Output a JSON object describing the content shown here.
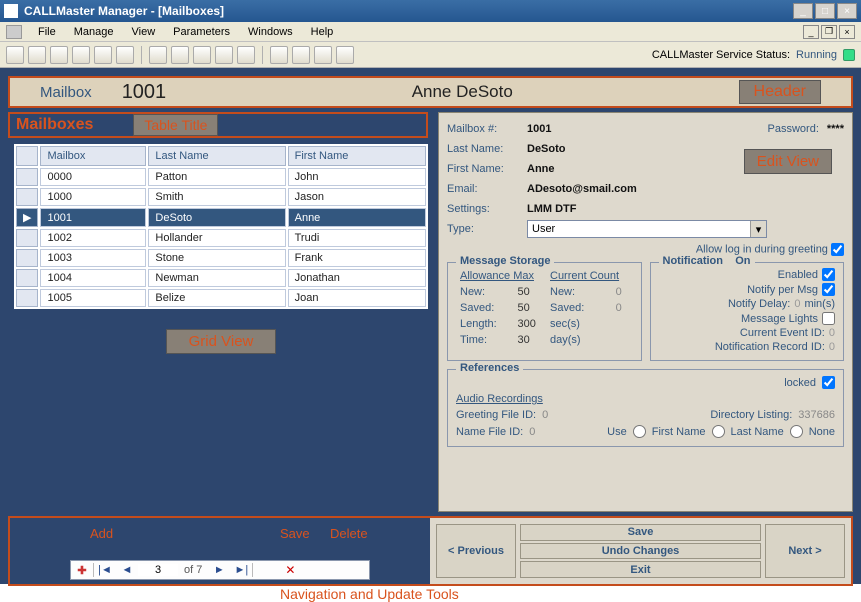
{
  "window": {
    "title": "CALLMaster Manager - [Mailboxes]",
    "min": "_",
    "max": "□",
    "close": "×"
  },
  "menu": {
    "file": "File",
    "manage": "Manage",
    "view": "View",
    "parameters": "Parameters",
    "windows": "Windows",
    "help": "Help"
  },
  "service": {
    "label": "CALLMaster Service Status:",
    "value": "Running"
  },
  "header": {
    "label": "Mailbox",
    "current_id": "1001",
    "current_name": "Anne DeSoto",
    "tag": "Header"
  },
  "tabletitle": {
    "label": "Mailboxes",
    "tag": "Table Title"
  },
  "gridview_tag": "Grid View",
  "grid": {
    "cols": {
      "mailbox": "Mailbox",
      "last": "Last Name",
      "first": "First Name"
    },
    "rows": [
      {
        "mailbox": "0000",
        "last": "Patton",
        "first": "John",
        "sel": false
      },
      {
        "mailbox": "1000",
        "last": "Smith",
        "first": "Jason",
        "sel": false
      },
      {
        "mailbox": "1001",
        "last": "DeSoto",
        "first": "Anne",
        "sel": true
      },
      {
        "mailbox": "1002",
        "last": "Hollander",
        "first": "Trudi",
        "sel": false
      },
      {
        "mailbox": "1003",
        "last": "Stone",
        "first": "Frank",
        "sel": false
      },
      {
        "mailbox": "1004",
        "last": "Newman",
        "first": "Jonathan",
        "sel": false
      },
      {
        "mailbox": "1005",
        "last": "Belize",
        "first": "Joan",
        "sel": false
      }
    ]
  },
  "edit": {
    "tag": "Edit View",
    "mailbox_label": "Mailbox #:",
    "mailbox": "1001",
    "pw_label": "Password:",
    "pw": "****",
    "last_label": "Last Name:",
    "last": "DeSoto",
    "first_label": "First Name:",
    "first": "Anne",
    "email_label": "Email:",
    "email": "ADesoto@smail.com",
    "settings_label": "Settings:",
    "settings": "LMM DTF",
    "type_label": "Type:",
    "type": "User",
    "allow_label": "Allow log in during greeting"
  },
  "msgstore": {
    "legend": "Message Storage",
    "allow_hdr": "Allowance Max",
    "count_hdr": "Current Count",
    "new_label": "New:",
    "new_max": "50",
    "new_cur": "0",
    "saved_label": "Saved:",
    "saved_max": "50",
    "saved_cur": "0",
    "len_label": "Length:",
    "len": "300",
    "len_unit": "sec(s)",
    "time_label": "Time:",
    "time": "30",
    "time_unit": "day(s)"
  },
  "notif": {
    "legend": "Notification",
    "state": "On",
    "enabled": "Enabled",
    "permsg": "Notify per Msg",
    "delay": "Notify Delay:",
    "delay_val": "0",
    "delay_unit": "min(s)",
    "lights": "Message Lights",
    "evt": "Current Event ID:",
    "evt_val": "0",
    "rec": "Notification Record ID:",
    "rec_val": "0"
  },
  "refs": {
    "legend": "References",
    "locked": "locked",
    "audio": "Audio Recordings",
    "gfile": "Greeting File ID:",
    "gfile_val": "0",
    "nfile": "Name File ID:",
    "nfile_val": "0",
    "dir": "Directory Listing:",
    "dir_val": "337686",
    "use": "Use",
    "opt_first": "First Name",
    "opt_last": "Last Name",
    "opt_none": "None"
  },
  "nav": {
    "add_annot": "Add",
    "save_annot": "Save",
    "del_annot": "Delete",
    "pos": "3",
    "of": "of 7",
    "tools_tag": "Navigation and Update Tools"
  },
  "btns": {
    "prev": "< Previous",
    "next": "Next >",
    "save": "Save",
    "undo": "Undo Changes",
    "exit": "Exit"
  }
}
